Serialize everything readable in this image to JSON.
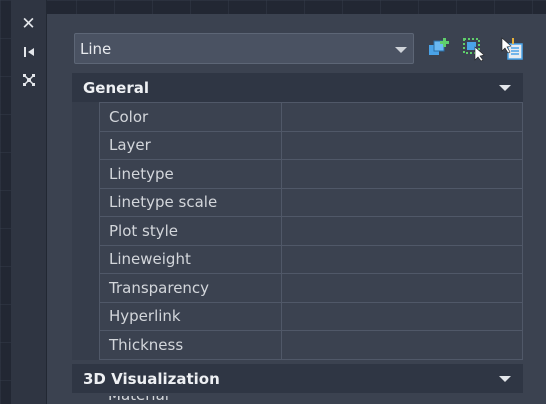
{
  "palette": {
    "object_type": "Line",
    "tools": [
      {
        "icon": "quick-select-icon"
      },
      {
        "icon": "select-objects-icon"
      },
      {
        "icon": "toggle-pickadd-icon"
      }
    ],
    "title_strip": [
      {
        "icon": "close-icon"
      },
      {
        "icon": "auto-hide-icon"
      },
      {
        "icon": "properties-settings-icon"
      }
    ]
  },
  "sections": [
    {
      "title": "General",
      "properties": [
        {
          "name": "Color",
          "value": ""
        },
        {
          "name": "Layer",
          "value": ""
        },
        {
          "name": "Linetype",
          "value": ""
        },
        {
          "name": "Linetype scale",
          "value": ""
        },
        {
          "name": "Plot style",
          "value": ""
        },
        {
          "name": "Lineweight",
          "value": ""
        },
        {
          "name": "Transparency",
          "value": ""
        },
        {
          "name": "Hyperlink",
          "value": ""
        },
        {
          "name": "Thickness",
          "value": ""
        }
      ]
    },
    {
      "title": "3D Visualization",
      "properties": [
        {
          "name": "Material",
          "value": ""
        }
      ]
    }
  ],
  "colors": {
    "palette_bg": "#3b4250",
    "header_bg": "#2f3644",
    "icon_blue": "#4aa3e8",
    "icon_green": "#5fce6b"
  }
}
